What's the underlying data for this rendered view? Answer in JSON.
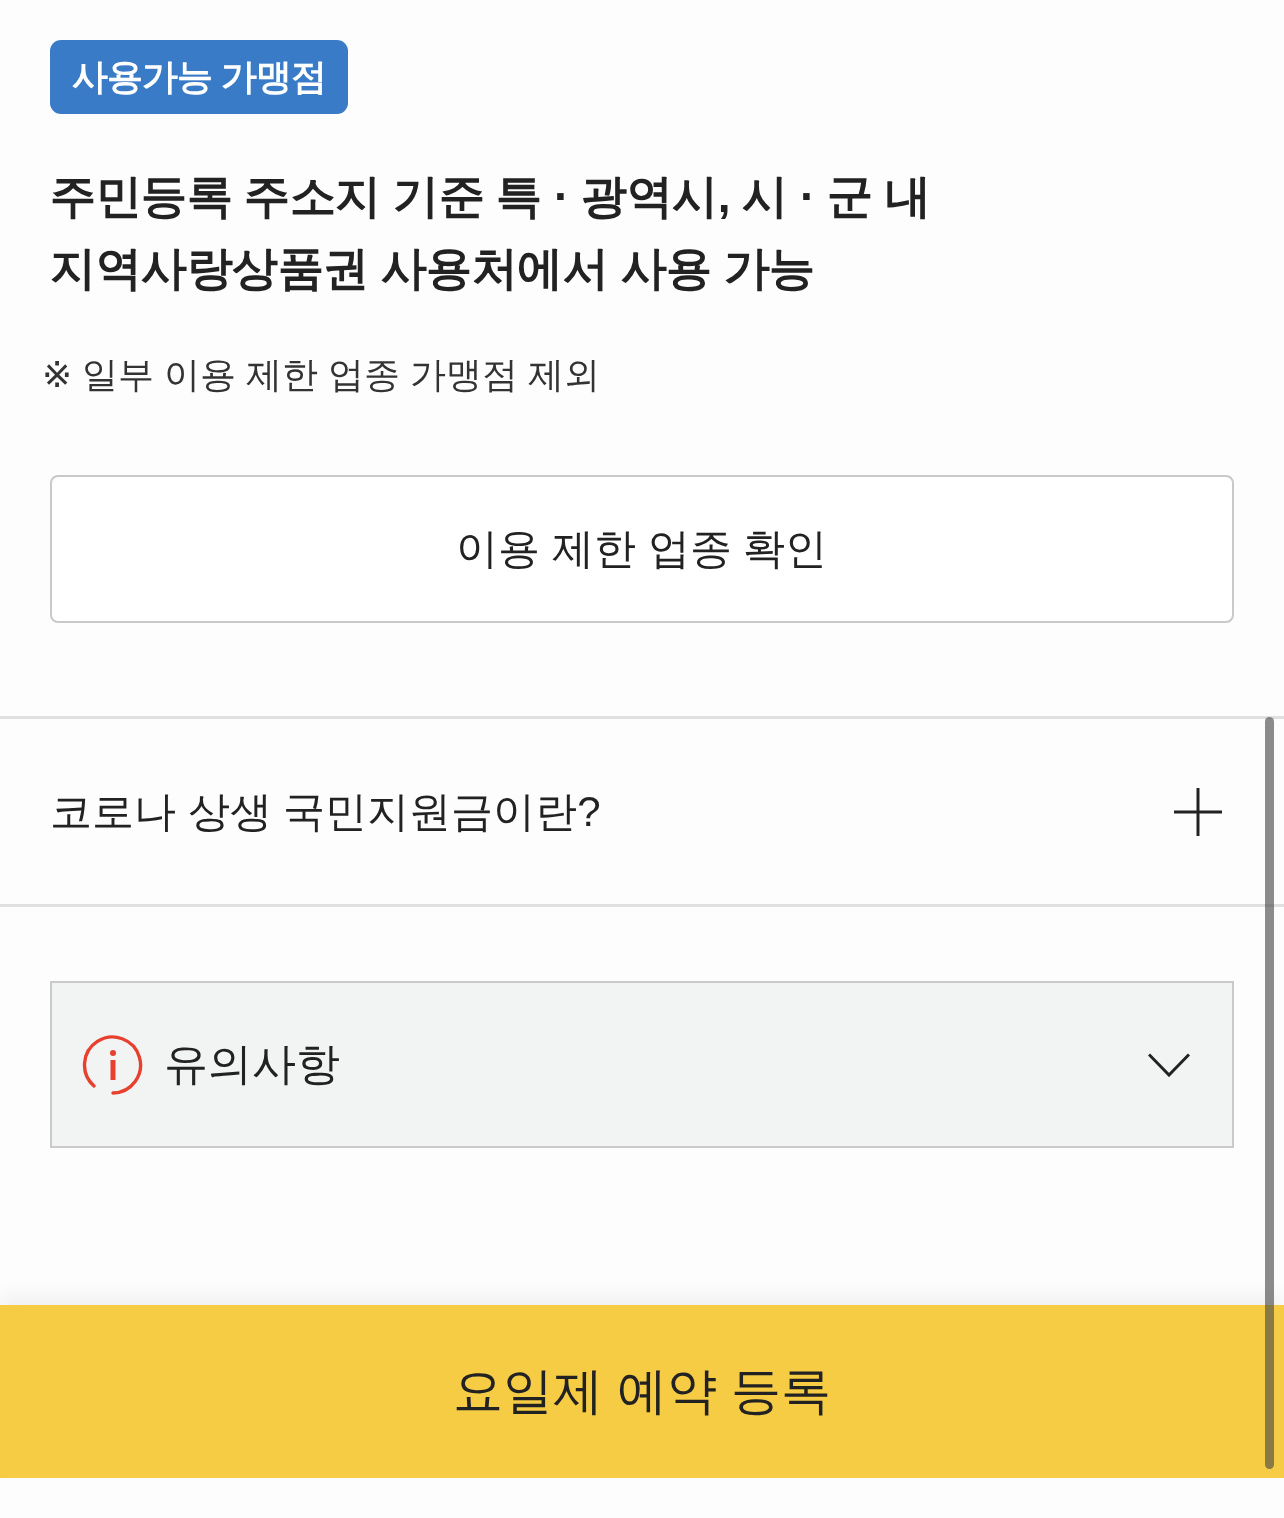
{
  "badge": {
    "label": "사용가능 가맹점"
  },
  "headline": "주민등록 주소지 기준 특 · 광역시, 시 · 군 내 지역사랑상품권 사용처에서 사용 가능",
  "note": "※ 일부 이용 제한 업종 가맹점 제외",
  "restricted_button": {
    "label": "이용 제한 업종 확인"
  },
  "faq": {
    "title": "코로나 상생 국민지원금이란?",
    "expanded": false
  },
  "notice": {
    "title": "유의사항",
    "expanded": false
  },
  "bottom_button": {
    "label": "요일제 예약 등록"
  }
}
